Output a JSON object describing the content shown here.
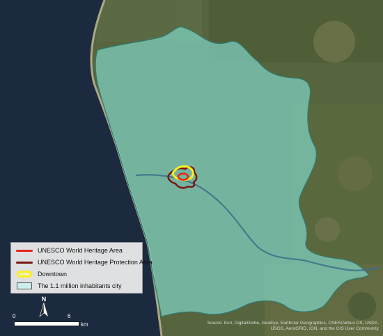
{
  "legend": {
    "items": [
      {
        "label": "UNESCO World Heritage Area",
        "symbol": "red-line",
        "color": "#e8231c"
      },
      {
        "label": "UNESCO World Heritage Protection Area",
        "symbol": "dark-red-line",
        "color": "#7a1616"
      },
      {
        "label": "Downtown",
        "symbol": "yellow-polygon",
        "color": "#f7ef1f"
      },
      {
        "label": "The 1.1 million inhabitants city",
        "symbol": "teal-polygon",
        "color": "#cdeeee"
      }
    ]
  },
  "north_arrow": {
    "label": "N"
  },
  "scale_bar": {
    "start": "0",
    "end": "6",
    "unit": "km"
  },
  "credits": "Source: Esri, DigitalGlobe, GeoEye, Earthstar Geographics, CNES/Airbus DS, USDA, USGS, AeroGRID, IGN, and the GIS User Community",
  "colors": {
    "sea": "#1b2a3e",
    "land": "#5a6a3f",
    "city_fill": "#7fd3c3",
    "city_outline": "#2f7a70"
  }
}
